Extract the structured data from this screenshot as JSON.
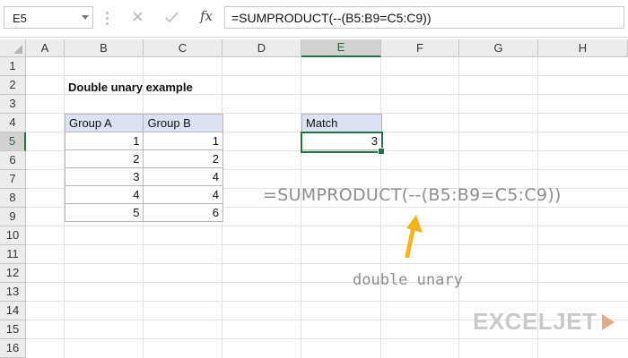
{
  "formula_bar": {
    "name_box": "E5",
    "fx_label": "fx",
    "formula": "=SUMPRODUCT(--(B5:B9=C5:C9))"
  },
  "columns": [
    "A",
    "B",
    "C",
    "D",
    "E",
    "F",
    "G",
    "H"
  ],
  "active_column": "E",
  "rows": [
    "1",
    "2",
    "3",
    "4",
    "5",
    "6",
    "7",
    "8",
    "9",
    "10",
    "11",
    "12",
    "13",
    "14",
    "15",
    "16"
  ],
  "active_row": "5",
  "sheet": {
    "title": "Double unary example",
    "table": {
      "headers": [
        "Group A",
        "Group B"
      ],
      "rows": [
        [
          "1",
          "1"
        ],
        [
          "2",
          "2"
        ],
        [
          "3",
          "4"
        ],
        [
          "4",
          "4"
        ],
        [
          "5",
          "6"
        ]
      ]
    },
    "match": {
      "header": "Match",
      "value": "3"
    }
  },
  "annotation": {
    "formula": "=SUMPRODUCT(--(B5:B9=C5:C9))",
    "label": "double unary"
  },
  "logo": {
    "text": "EXCELJET"
  },
  "colors": {
    "selection": "#217346",
    "header_fill": "#dbe2f2",
    "arrow": "#f2b51c",
    "annotation_text": "#8d8d8d"
  }
}
